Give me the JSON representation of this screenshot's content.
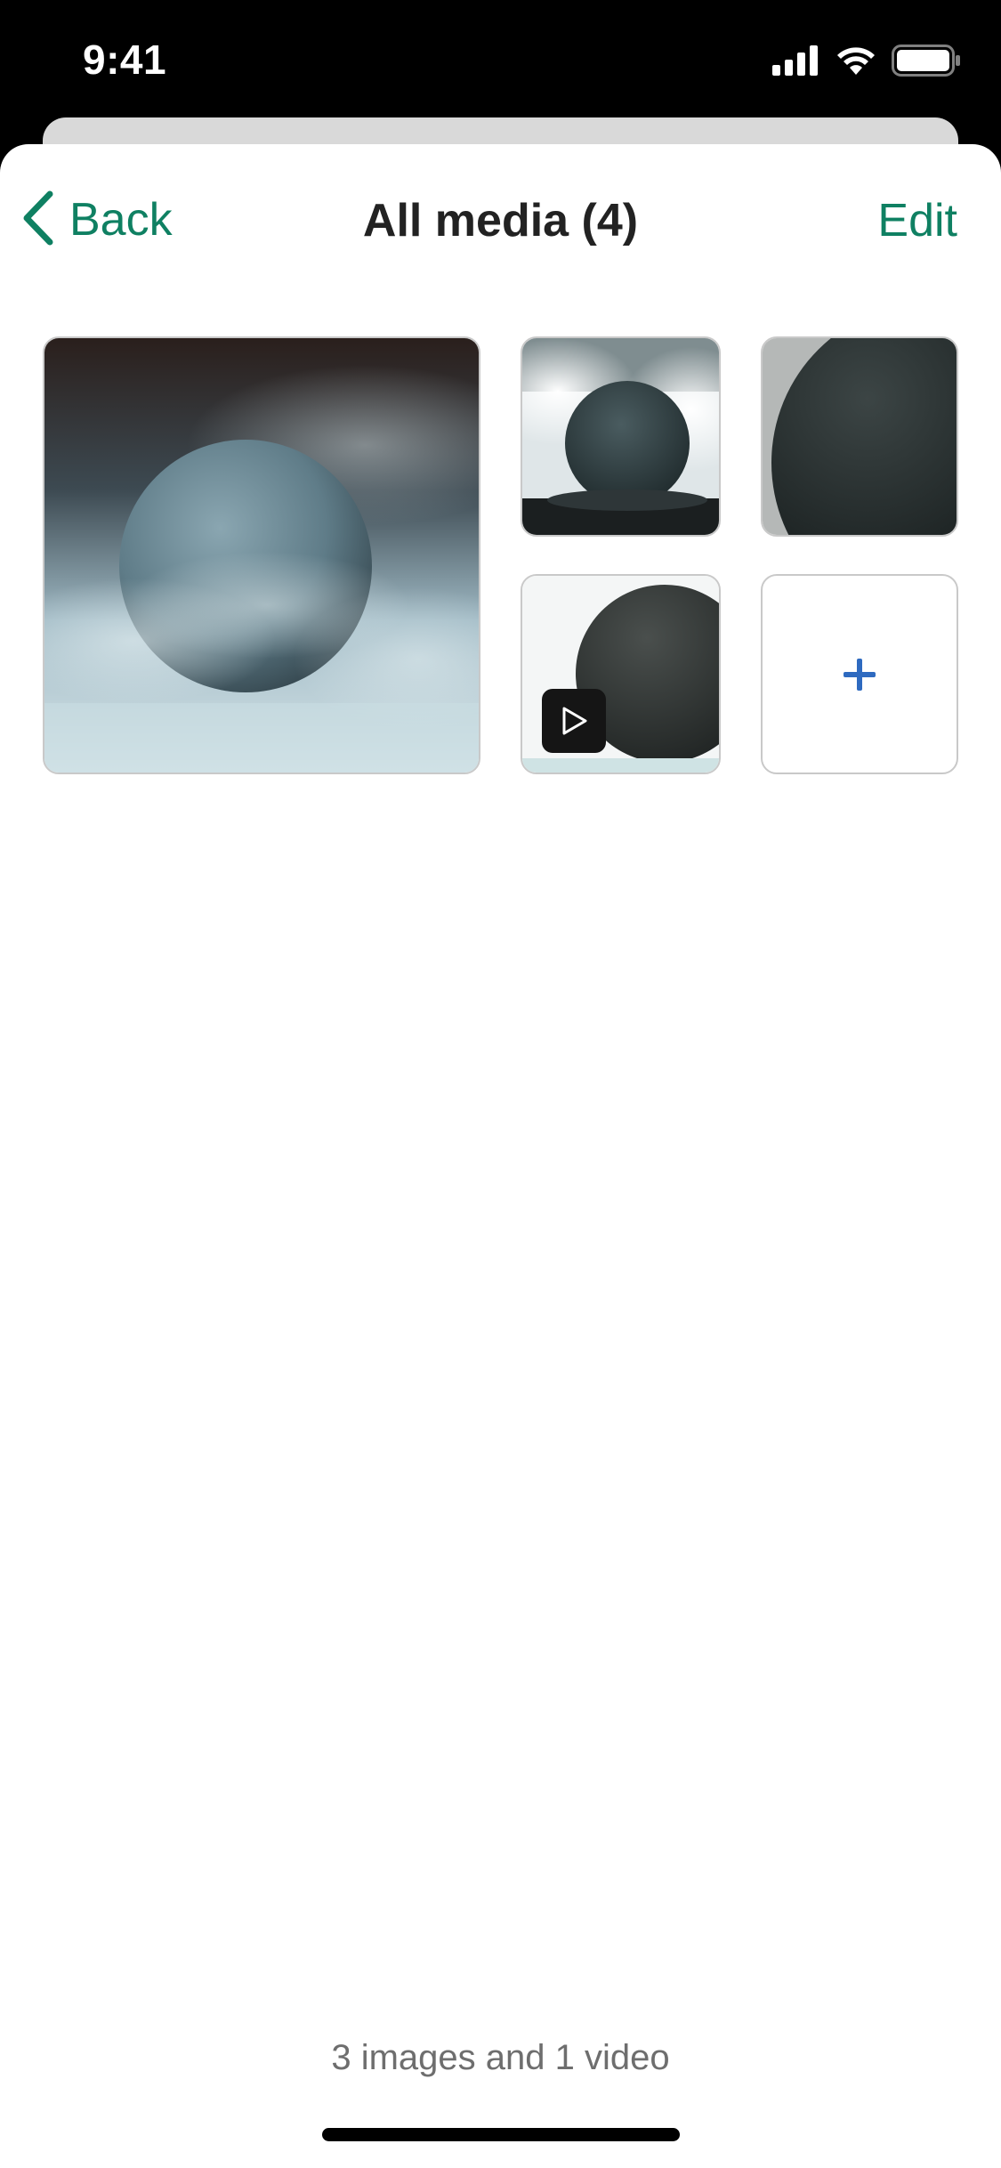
{
  "status_bar": {
    "time": "9:41",
    "icons": [
      "cellular-signal-icon",
      "wifi-icon",
      "battery-icon"
    ]
  },
  "nav": {
    "back_label": "Back",
    "back_icon": "chevron-left-icon",
    "title": "All media (4)",
    "edit_label": "Edit"
  },
  "media": {
    "items": [
      {
        "type": "image",
        "name": "media-item-1"
      },
      {
        "type": "image",
        "name": "media-item-2"
      },
      {
        "type": "image",
        "name": "media-item-3"
      },
      {
        "type": "video",
        "name": "media-item-4",
        "badge_icon": "play-icon"
      }
    ],
    "add_button_icon": "plus-icon"
  },
  "footer": {
    "summary": "3 images and 1 video"
  },
  "colors": {
    "accent": "#0f8062",
    "add_icon": "#2e6ac0",
    "title": "#222222",
    "footer_text": "#6e6e6e"
  }
}
